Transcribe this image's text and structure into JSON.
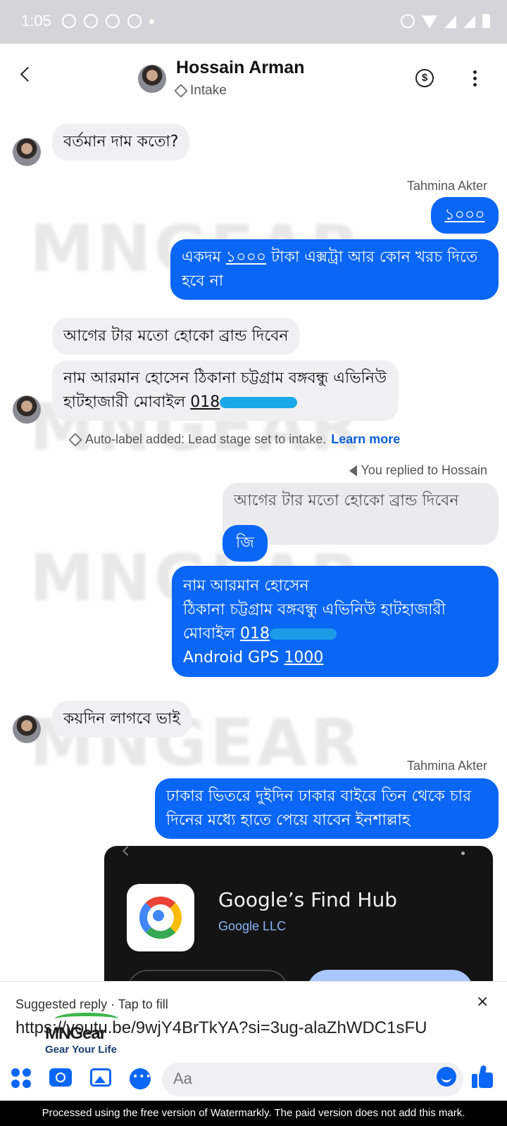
{
  "status_bar": {
    "time": "1:05"
  },
  "header": {
    "name": "Hossain Arman",
    "label": "Intake"
  },
  "watermark": "MNGEAR",
  "messages": {
    "m1": "বর্তমান দাম কতো?",
    "sender1": "Tahmina Akter",
    "m2": "১০০০",
    "m3a": "একদম ",
    "m3b": "১০০০",
    "m3c": " টাকা এক্সট্রা আর কোন খরচ দিতে হবে না",
    "m4": "আগের টার মতো হোকো ব্রান্ড দিবেন",
    "m5a": "নাম আরমান হোসেন ঠিকানা চট্টগ্রাম বঙ্গবন্ধু এভিনিউ হাটহাজারী মোবাইল ",
    "m5b": "018",
    "system_note": "Auto-label added: Lead stage set to intake.",
    "learn_more": "Learn more",
    "replied_to": "You replied to Hossain",
    "quoted": "আগের টার মতো হোকো ব্রান্ড দিবেন",
    "m6": "জি",
    "m7a": "নাম আরমান হোসেন",
    "m7b": "ঠিকানা চট্টগ্রাম বঙ্গবন্ধু এভিনিউ হাটহাজারী",
    "m7c": "মোবাইল ",
    "m7d": "018",
    "m7e": "Android GPS ",
    "m7f": "1000",
    "m8": "কয়দিন লাগবে ভাই",
    "sender2": "Tahmina Akter",
    "m9": "ঢাকার ভিতরে দুইদিন ঢাকার বাইরে তিন থেকে চার দিনের মধ্যে হাতে পেয়ে যাবেন ইনশাল্লাহ"
  },
  "preview_card": {
    "title": "Google’s Find Hub",
    "developer": "Google LLC"
  },
  "suggested_reply": {
    "label": "Suggested reply · Tap to fill",
    "link": "https://youtu.be/9wjY4BrTkYA?si=3ug-alaZhWDC1sFU",
    "close": "×"
  },
  "logo": {
    "brand": "MNGear",
    "tagline": "Gear Your Life"
  },
  "composer": {
    "placeholder": "Aa"
  },
  "banner": "Processed using the free version of Watermarkly. The paid version does not add this mark."
}
